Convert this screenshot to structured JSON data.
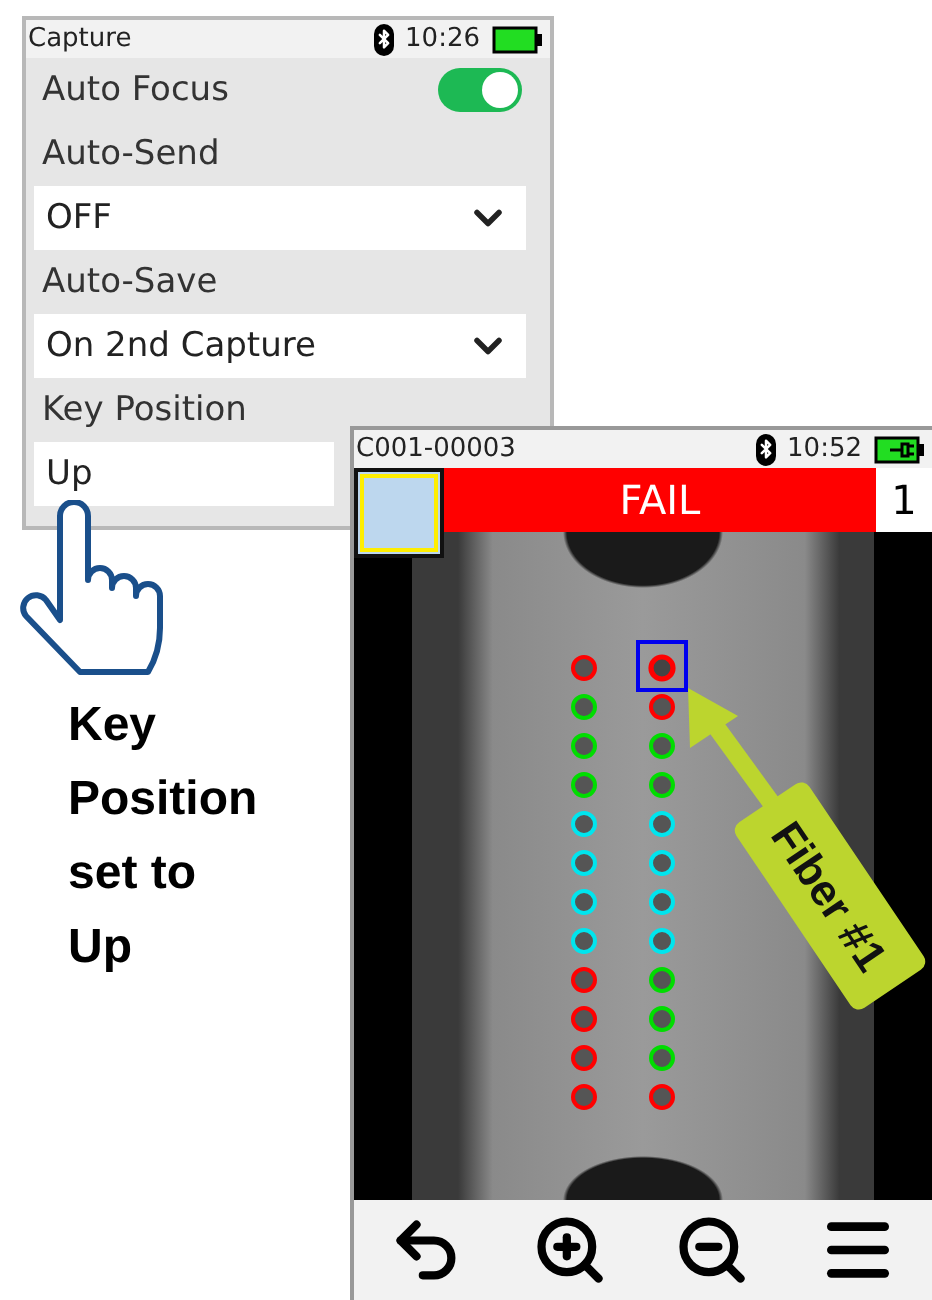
{
  "settings_screen": {
    "title": "Capture",
    "time": "10:26",
    "rows": [
      {
        "kind": "toggle",
        "label": "Auto Focus",
        "on": true
      },
      {
        "kind": "dropdown",
        "label": "Auto-Send",
        "value": "OFF"
      },
      {
        "kind": "dropdown",
        "label": "Auto-Save",
        "value": "On 2nd Capture"
      },
      {
        "kind": "field",
        "label": "Key Position",
        "value": "Up"
      }
    ]
  },
  "inspection_screen": {
    "title": "C001-00003",
    "time": "10:52",
    "result": {
      "text": "FAIL",
      "kind": "fail"
    },
    "count": "1",
    "fiber_columns": [
      {
        "fibers": [
          {
            "color": "#ff0000",
            "selected": false
          },
          {
            "color": "#00dd00",
            "selected": false
          },
          {
            "color": "#00dd00",
            "selected": false
          },
          {
            "color": "#00dd00",
            "selected": false
          },
          {
            "color": "#00e5ee",
            "selected": false
          },
          {
            "color": "#00e5ee",
            "selected": false
          },
          {
            "color": "#00e5ee",
            "selected": false
          },
          {
            "color": "#00e5ee",
            "selected": false
          },
          {
            "color": "#ff0000",
            "selected": false
          },
          {
            "color": "#ff0000",
            "selected": false
          },
          {
            "color": "#ff0000",
            "selected": false
          },
          {
            "color": "#ff0000",
            "selected": false
          }
        ]
      },
      {
        "fibers": [
          {
            "color": "#ff0000",
            "selected": true
          },
          {
            "color": "#ff0000",
            "selected": false
          },
          {
            "color": "#00dd00",
            "selected": false
          },
          {
            "color": "#00dd00",
            "selected": false
          },
          {
            "color": "#00e5ee",
            "selected": false
          },
          {
            "color": "#00e5ee",
            "selected": false
          },
          {
            "color": "#00e5ee",
            "selected": false
          },
          {
            "color": "#00e5ee",
            "selected": false
          },
          {
            "color": "#00dd00",
            "selected": false
          },
          {
            "color": "#00dd00",
            "selected": false
          },
          {
            "color": "#00dd00",
            "selected": false
          },
          {
            "color": "#ff0000",
            "selected": false
          }
        ]
      }
    ],
    "callout": "Fiber #1"
  },
  "caption": "Key Position set to Up"
}
